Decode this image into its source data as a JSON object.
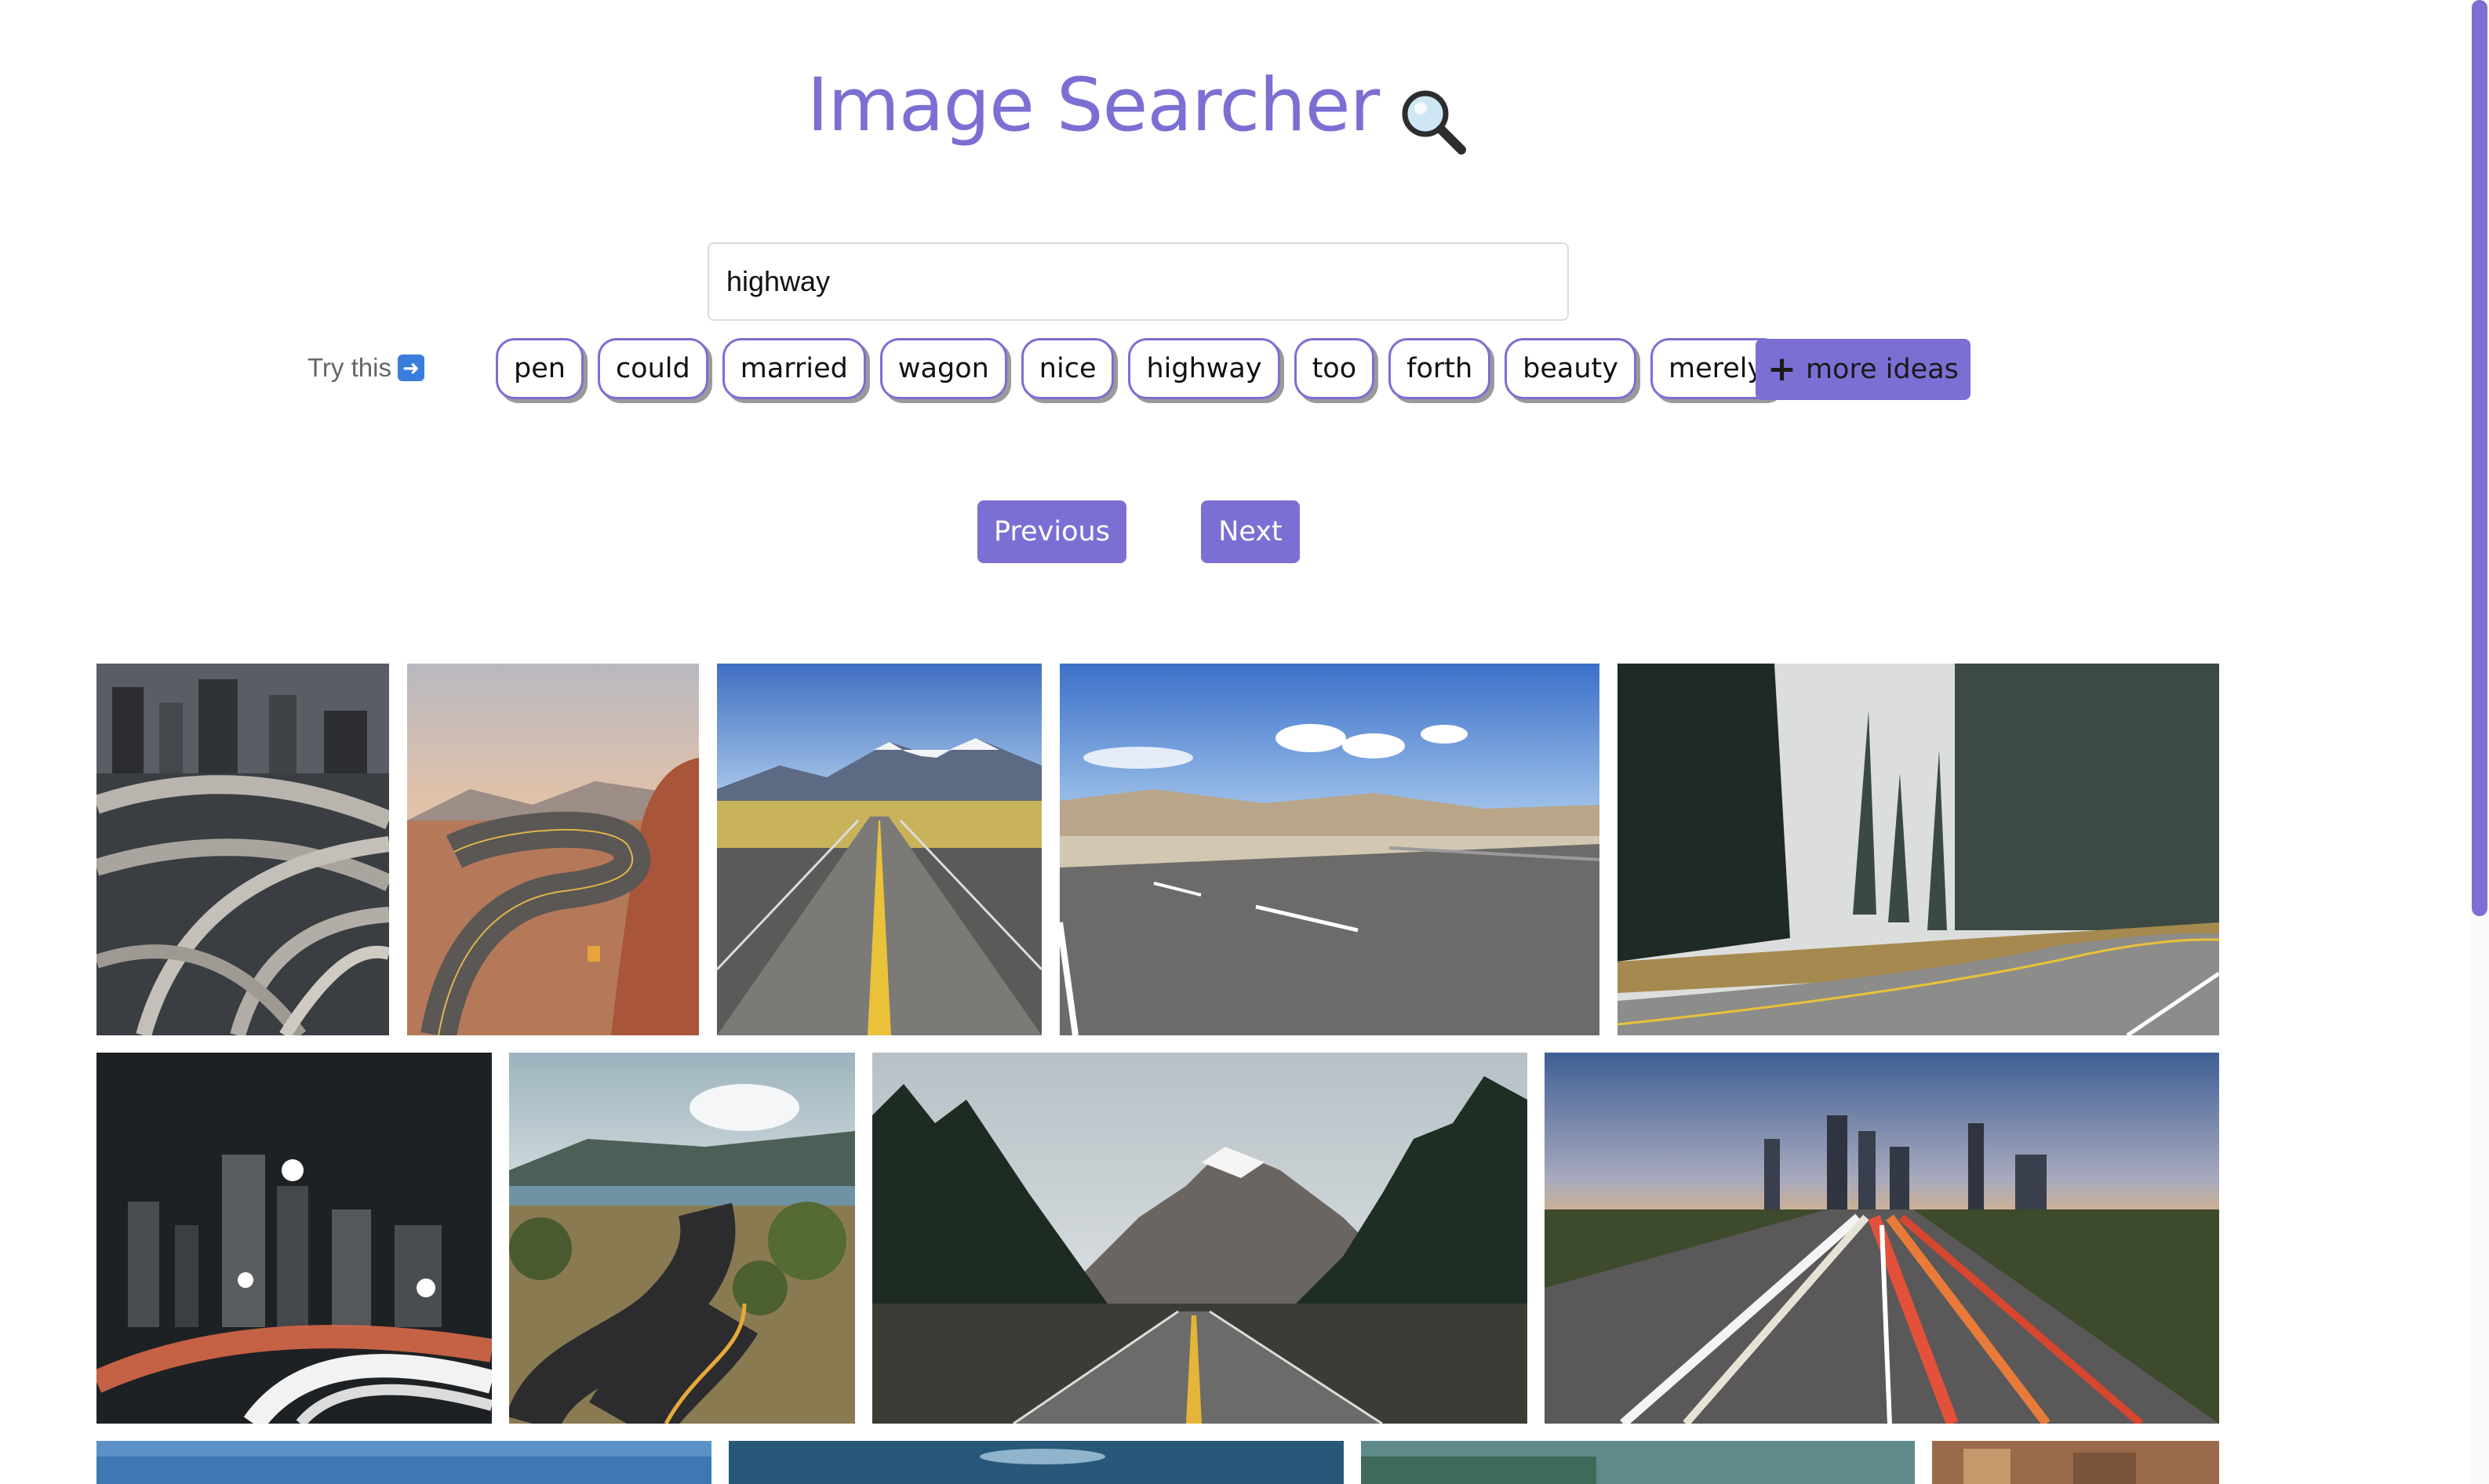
{
  "header": {
    "title": "Image Searcher",
    "icon": "magnifying-glass-icon"
  },
  "search": {
    "value": "highway"
  },
  "suggestions": {
    "label": "Try this",
    "arrow_icon": "right-arrow-icon",
    "words": [
      "pen",
      "could",
      "married",
      "wagon",
      "nice",
      "highway",
      "too",
      "forth",
      "beauty",
      "merely"
    ],
    "more_label": "more ideas"
  },
  "pagination": {
    "previous": "Previous",
    "next": "Next"
  },
  "colors": {
    "accent": "#7c6fd3",
    "chip_shadow": "#9a9a9a",
    "text": "#111111"
  }
}
